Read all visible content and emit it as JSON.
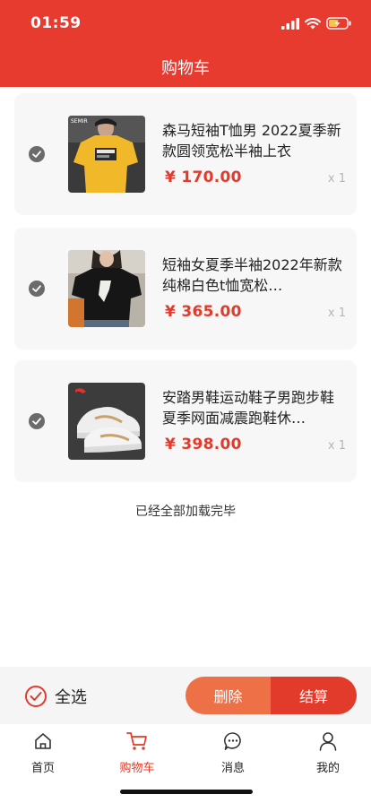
{
  "status": {
    "time": "01:59"
  },
  "header": {
    "title": "购物车"
  },
  "items": [
    {
      "title": "森马短袖T恤男 2022夏季新款圆领宽松半袖上衣",
      "price": "¥ 170.00",
      "qty": "x 1"
    },
    {
      "title": "短袖女夏季半袖2022年新款纯棉白色t恤宽松…",
      "price": "¥ 365.00",
      "qty": "x 1"
    },
    {
      "title": "安踏男鞋运动鞋子男跑步鞋夏季网面减震跑鞋休…",
      "price": "¥ 398.00",
      "qty": "x 1"
    }
  ],
  "list_end": "已经全部加载完毕",
  "checkout": {
    "select_all": "全选",
    "delete": "删除",
    "settle": "结算"
  },
  "tabs": [
    {
      "label": "首页",
      "icon": "home-icon"
    },
    {
      "label": "购物车",
      "icon": "cart-icon"
    },
    {
      "label": "消息",
      "icon": "message-icon"
    },
    {
      "label": "我的",
      "icon": "user-icon"
    }
  ],
  "colors": {
    "accent": "#e83b2f",
    "price": "#e23a2b",
    "delete": "#ee7046"
  }
}
